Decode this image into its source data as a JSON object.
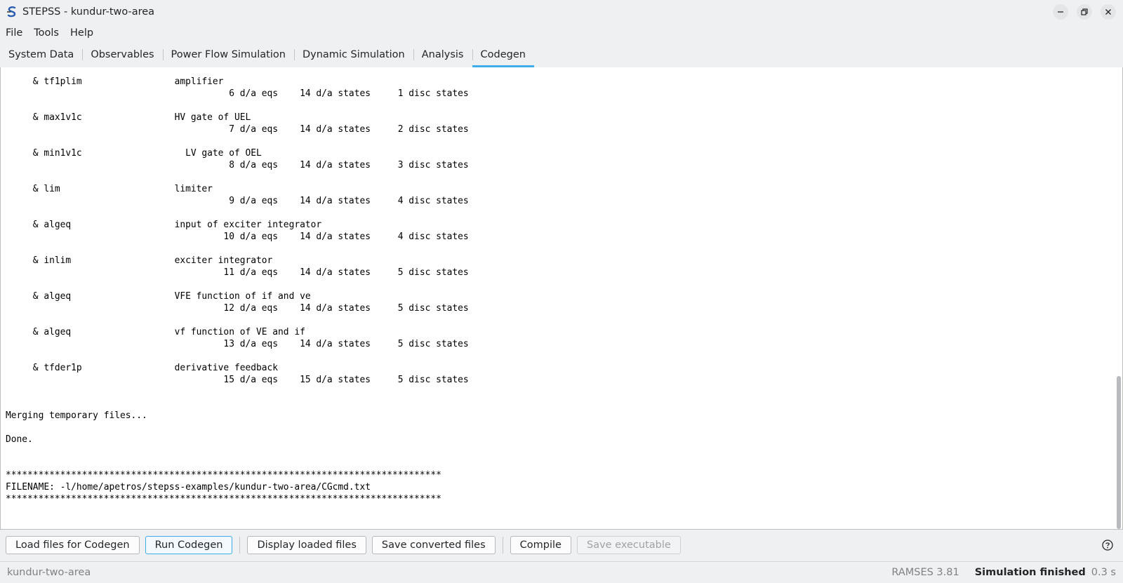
{
  "window": {
    "title": "STEPSS - kundur-two-area",
    "logo": "stepss-s-logo",
    "controls": [
      "minimize-icon",
      "restore-icon",
      "close-icon"
    ]
  },
  "menu": {
    "items": [
      "File",
      "Tools",
      "Help"
    ]
  },
  "tabs": {
    "items": [
      {
        "label": "System Data",
        "active": false
      },
      {
        "label": "Observables",
        "active": false
      },
      {
        "label": "Power Flow Simulation",
        "active": false
      },
      {
        "label": "Dynamic Simulation",
        "active": false
      },
      {
        "label": "Analysis",
        "active": false
      },
      {
        "label": "Codegen",
        "active": true
      }
    ]
  },
  "console": {
    "lines": [
      "     & tf1plim                 amplifier",
      "                                         6 d/a eqs    14 d/a states     1 disc states",
      "",
      "     & max1v1c                 HV gate of UEL",
      "                                         7 d/a eqs    14 d/a states     2 disc states",
      "",
      "     & min1v1c                   LV gate of OEL",
      "                                         8 d/a eqs    14 d/a states     3 disc states",
      "",
      "     & lim                     limiter",
      "                                         9 d/a eqs    14 d/a states     4 disc states",
      "",
      "     & algeq                   input of exciter integrator",
      "                                        10 d/a eqs    14 d/a states     4 disc states",
      "",
      "     & inlim                   exciter integrator",
      "                                        11 d/a eqs    14 d/a states     5 disc states",
      "",
      "     & algeq                   VFE function of if and ve",
      "                                        12 d/a eqs    14 d/a states     5 disc states",
      "",
      "     & algeq                   vf function of VE and if",
      "                                        13 d/a eqs    14 d/a states     5 disc states",
      "",
      "     & tfder1p                 derivative feedback",
      "                                        15 d/a eqs    15 d/a states     5 disc states",
      "",
      "",
      "Merging temporary files...",
      "",
      "Done.",
      "",
      "",
      "********************************************************************************",
      "FILENAME: -l/home/apetros/stepss-examples/kundur-two-area/CGcmd.txt",
      "********************************************************************************"
    ]
  },
  "buttons": {
    "load": "Load files for Codegen",
    "run": "Run Codegen",
    "display": "Display loaded files",
    "save": "Save converted files",
    "compile": "Compile",
    "save_exec": "Save executable",
    "help_icon": "help-icon"
  },
  "status": {
    "project": "kundur-two-area",
    "version": "RAMSES 3.81",
    "state": "Simulation finished",
    "time": "0.3 s"
  }
}
